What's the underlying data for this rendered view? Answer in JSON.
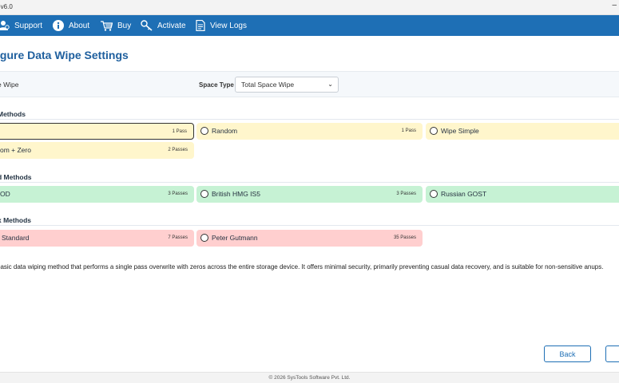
{
  "window": {
    "title": "e v6.0",
    "minimize_glyph": "–"
  },
  "menu": [
    {
      "label": "Support",
      "icon": "support-icon"
    },
    {
      "label": "About",
      "icon": "info-icon"
    },
    {
      "label": "Buy",
      "icon": "cart-icon"
    },
    {
      "label": "Activate",
      "icon": "key-icon"
    },
    {
      "label": "View Logs",
      "icon": "logs-icon"
    }
  ],
  "page_title": "igure Data Wipe Settings",
  "settings": {
    "wipe_label": "e Wipe",
    "space_type_label": "Space Type",
    "space_type_value": "Total Space Wipe"
  },
  "sections": [
    {
      "title": "Methods",
      "color": "yellow",
      "methods": [
        {
          "name": "",
          "passes": "1 Pass",
          "selected": true
        },
        {
          "name": "Random",
          "passes": "1 Pass"
        },
        {
          "name": "Wipe Simple",
          "passes": ""
        },
        {
          "name": "om + Zero",
          "passes": "2 Passes"
        }
      ]
    },
    {
      "title": "d Methods",
      "color": "green",
      "methods": [
        {
          "name": "OD",
          "passes": "3 Passes"
        },
        {
          "name": "British HMG IS5",
          "passes": "3 Passes"
        },
        {
          "name": "Russian GOST",
          "passes": ""
        }
      ]
    },
    {
      "title": "x Methods",
      "color": "red",
      "methods": [
        {
          "name": "Standard",
          "passes": "7 Passes"
        },
        {
          "name": "Peter Gutmann",
          "passes": "35 Passes"
        }
      ]
    }
  ],
  "description": "basic data wiping method that performs a single pass overwrite with zeros across the entire storage device. It offers minimal security, primarily preventing casual data recovery, and is suitable for non-sensitive anups.",
  "buttons": {
    "back": "Back"
  },
  "footer": "© 2026 SysTools Software Pvt. Ltd.",
  "colors": {
    "menubar": "#1e6fb5",
    "title": "#1e5f9e",
    "yellow": "#fff6cc",
    "green": "#c6f2d4",
    "red": "#ffcfcf"
  }
}
